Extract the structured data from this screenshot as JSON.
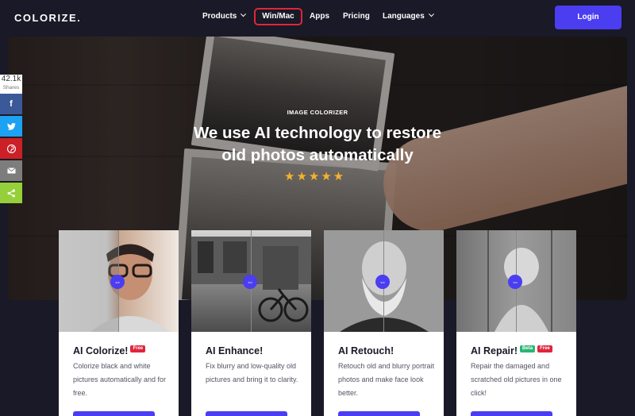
{
  "nav": {
    "logo": "COLORIZE.",
    "items": [
      {
        "label": "Products",
        "dropdown": true
      },
      {
        "label": "Win/Mac",
        "dropdown": false
      },
      {
        "label": "Apps",
        "dropdown": false
      },
      {
        "label": "Pricing",
        "dropdown": false
      },
      {
        "label": "Languages",
        "dropdown": true
      }
    ],
    "login": "Login"
  },
  "hero": {
    "eyebrow": "IMAGE COLORIZER",
    "headline_line1": "We use AI technology to restore",
    "headline_line2": "old photos automatically",
    "rating_stars": 5,
    "stars_text": "★★★★★"
  },
  "share": {
    "count": "42.1k",
    "label": "Shares",
    "buttons": [
      {
        "name": "facebook",
        "glyph": "f",
        "color": "#3b5998"
      },
      {
        "name": "twitter",
        "glyph": "t",
        "color": "#1da1f2"
      },
      {
        "name": "pinterest",
        "glyph": "p",
        "color": "#cb2027"
      },
      {
        "name": "email",
        "glyph": "✉",
        "color": "#7d7d7d"
      },
      {
        "name": "sharethis",
        "glyph": "<",
        "color": "#95d03a"
      }
    ]
  },
  "cards": [
    {
      "title": "AI Colorize!",
      "badges": [
        "Free"
      ],
      "desc": "Colorize black and white pictures automatically and for free."
    },
    {
      "title": "AI Enhance!",
      "badges": [],
      "desc": "Fix blurry and low-quality old pictures and bring it to clarity."
    },
    {
      "title": "AI Retouch!",
      "badges": [],
      "desc": "Retouch old and blurry portrait photos and make face look better."
    },
    {
      "title": "AI Repair!",
      "badges": [
        "Beta",
        "Free"
      ],
      "desc": "Repair the damaged and scratched old pictures in one click!"
    }
  ],
  "colors": {
    "accent": "#4b3df0",
    "background": "#191927",
    "highlight_border": "#e0253b",
    "star": "#f4b22d"
  }
}
